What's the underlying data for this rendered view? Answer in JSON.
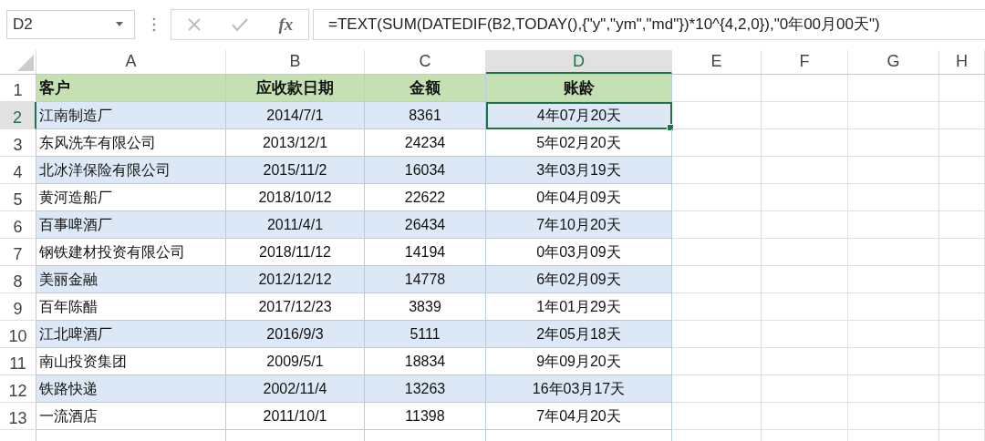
{
  "formula_bar": {
    "name_box": "D2",
    "fx_label": "fx",
    "formula": "=TEXT(SUM(DATEDIF(B2,TODAY(),{\"y\",\"ym\",\"md\"})*10^{4,2,0}),\"0年00月00天\")"
  },
  "sheet": {
    "columns": [
      {
        "label": "A",
        "selected": false
      },
      {
        "label": "B",
        "selected": false
      },
      {
        "label": "C",
        "selected": false
      },
      {
        "label": "D",
        "selected": true
      },
      {
        "label": "E",
        "selected": false
      },
      {
        "label": "F",
        "selected": false
      },
      {
        "label": "G",
        "selected": false
      },
      {
        "label": "H",
        "selected": false
      }
    ],
    "rows": [
      {
        "number": "1",
        "kind": "header",
        "shaded": false,
        "selected": false,
        "cells": [
          "客户",
          "应收款日期",
          "金额",
          "账龄"
        ]
      },
      {
        "number": "2",
        "kind": "data",
        "shaded": true,
        "selected": true,
        "cells": [
          "江南制造厂",
          "2014/7/1",
          "8361",
          "4年07月20天"
        ]
      },
      {
        "number": "3",
        "kind": "data",
        "shaded": false,
        "selected": false,
        "cells": [
          "东风洗车有限公司",
          "2013/12/1",
          "24234",
          "5年02月20天"
        ]
      },
      {
        "number": "4",
        "kind": "data",
        "shaded": true,
        "selected": false,
        "cells": [
          "北冰洋保险有限公司",
          "2015/11/2",
          "16034",
          "3年03月19天"
        ]
      },
      {
        "number": "5",
        "kind": "data",
        "shaded": false,
        "selected": false,
        "cells": [
          "黄河造船厂",
          "2018/10/12",
          "22622",
          "0年04月09天"
        ]
      },
      {
        "number": "6",
        "kind": "data",
        "shaded": true,
        "selected": false,
        "cells": [
          "百事啤酒厂",
          "2011/4/1",
          "26434",
          "7年10月20天"
        ]
      },
      {
        "number": "7",
        "kind": "data",
        "shaded": false,
        "selected": false,
        "cells": [
          "钢铁建材投资有限公司",
          "2018/11/12",
          "14194",
          "0年03月09天"
        ]
      },
      {
        "number": "8",
        "kind": "data",
        "shaded": true,
        "selected": false,
        "cells": [
          "美丽金融",
          "2012/12/12",
          "14778",
          "6年02月09天"
        ]
      },
      {
        "number": "9",
        "kind": "data",
        "shaded": false,
        "selected": false,
        "cells": [
          "百年陈醋",
          "2017/12/23",
          "3839",
          "1年01月29天"
        ]
      },
      {
        "number": "10",
        "kind": "data",
        "shaded": true,
        "selected": false,
        "cells": [
          "江北啤酒厂",
          "2016/9/3",
          "5111",
          "2年05月18天"
        ]
      },
      {
        "number": "11",
        "kind": "data",
        "shaded": false,
        "selected": false,
        "cells": [
          "南山投资集团",
          "2009/5/1",
          "18834",
          "9年09月20天"
        ]
      },
      {
        "number": "12",
        "kind": "data",
        "shaded": true,
        "selected": false,
        "cells": [
          "铁路快递",
          "2002/11/4",
          "13263",
          "16年03月17天"
        ]
      },
      {
        "number": "13",
        "kind": "data",
        "shaded": false,
        "selected": false,
        "cells": [
          "一流酒店",
          "2011/10/1",
          "11398",
          "7年04月20天"
        ]
      }
    ]
  }
}
